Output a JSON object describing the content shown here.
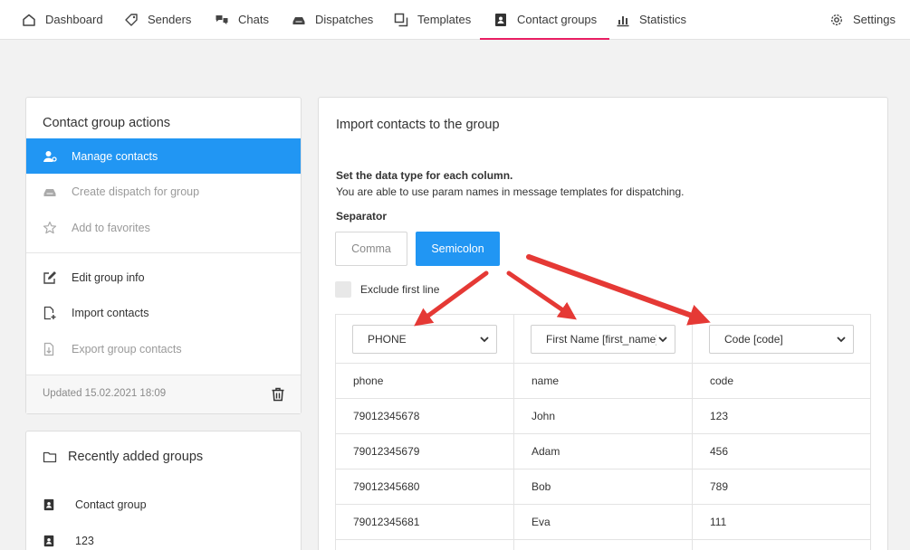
{
  "nav": {
    "dashboard": "Dashboard",
    "senders": "Senders",
    "chats": "Chats",
    "dispatches": "Dispatches",
    "templates": "Templates",
    "contact_groups": "Contact groups",
    "statistics": "Statistics",
    "settings": "Settings",
    "active_color": "#e91e63"
  },
  "left_panel": {
    "title": "Contact group actions",
    "items": [
      {
        "label": "Manage contacts",
        "state": "active"
      },
      {
        "label": "Create dispatch for group",
        "state": "disabled"
      },
      {
        "label": "Add to favorites",
        "state": "disabled"
      },
      {
        "label": "Edit group info",
        "state": "normal"
      },
      {
        "label": "Import contacts",
        "state": "normal"
      },
      {
        "label": "Export group contacts",
        "state": "disabled"
      }
    ],
    "updated": "Updated 15.02.2021 18:09",
    "accent_color": "#2196f3"
  },
  "recent_panel": {
    "title": "Recently added groups",
    "groups": [
      "Contact group",
      "123"
    ]
  },
  "import": {
    "title": "Import contacts to the group",
    "instruction_bold": "Set the data type for each column.",
    "instruction": "You are able to use param names in message templates for dispatching.",
    "separator_label": "Separator",
    "separator_options": [
      "Comma",
      "Semicolon"
    ],
    "separator_selected": "Semicolon",
    "exclude_first_line": "Exclude first line",
    "exclude_checked": false,
    "column_types": [
      "PHONE",
      "First Name [first_name]",
      "Code [code]"
    ],
    "header_row": [
      "phone",
      "name",
      "code"
    ],
    "rows": [
      [
        "79012345678",
        "John",
        "123"
      ],
      [
        "79012345679",
        "Adam",
        "456"
      ],
      [
        "79012345680",
        "Bob",
        "789"
      ],
      [
        "79012345681",
        "Eva",
        "111"
      ]
    ],
    "arrow_color": "#e53935"
  }
}
